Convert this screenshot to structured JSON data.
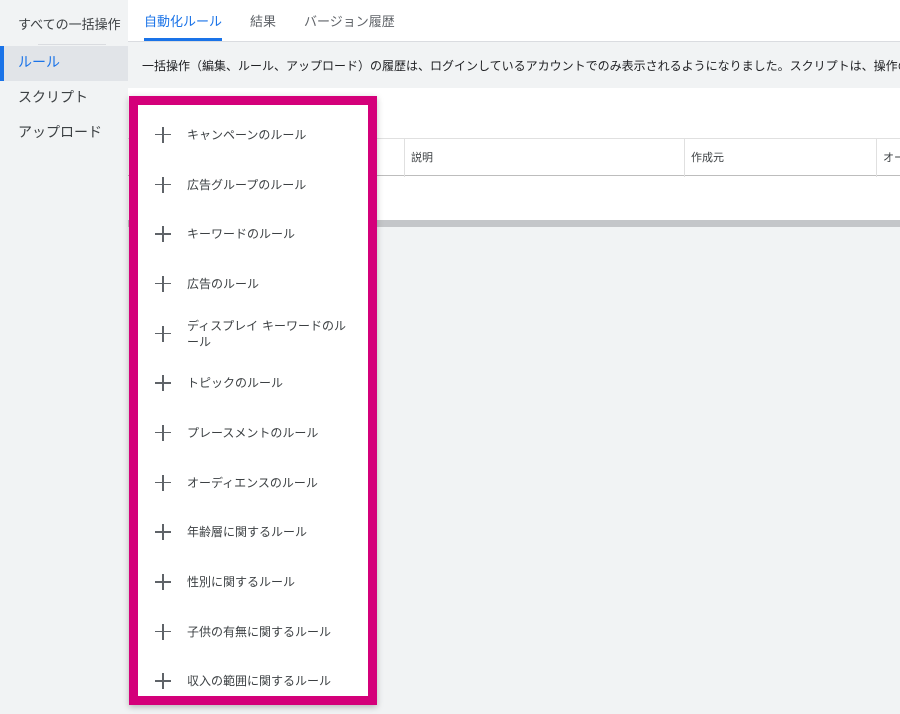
{
  "sidebar": {
    "title": "すべての一括操作",
    "items": [
      {
        "label": "ルール",
        "active": true
      },
      {
        "label": "スクリプト",
        "active": false
      },
      {
        "label": "アップロード",
        "active": false
      }
    ]
  },
  "tabs": [
    {
      "label": "自動化ルール",
      "active": true
    },
    {
      "label": "結果",
      "active": false
    },
    {
      "label": "バージョン履歴",
      "active": false
    }
  ],
  "notice": "一括操作（編集、ルール、アップロード）の履歴は、ログインしているアカウントでのみ表示されるようになりました。スクリプトは、操作の対象",
  "table": {
    "columns": [
      "説明",
      "作成元",
      "オー"
    ]
  },
  "menu": {
    "items": [
      {
        "icon": "plus-icon",
        "label": "キャンペーンのルール"
      },
      {
        "icon": "plus-icon",
        "label": "広告グループのルール"
      },
      {
        "icon": "plus-icon",
        "label": "キーワードのルール"
      },
      {
        "icon": "plus-icon",
        "label": "広告のルール"
      },
      {
        "icon": "plus-icon",
        "label": "ディスプレイ キーワードのルール"
      },
      {
        "icon": "plus-icon",
        "label": "トピックのルール"
      },
      {
        "icon": "plus-icon",
        "label": "プレースメントのルール"
      },
      {
        "icon": "plus-icon",
        "label": "オーディエンスのルール"
      },
      {
        "icon": "plus-icon",
        "label": "年齢層に関するルール"
      },
      {
        "icon": "plus-icon",
        "label": "性別に関するルール"
      },
      {
        "icon": "plus-icon",
        "label": "子供の有無に関するルール"
      },
      {
        "icon": "plus-icon",
        "label": "収入の範囲に関するルール"
      }
    ]
  },
  "colors": {
    "accent": "#1a73e8",
    "highlight_border": "#d4007a"
  }
}
